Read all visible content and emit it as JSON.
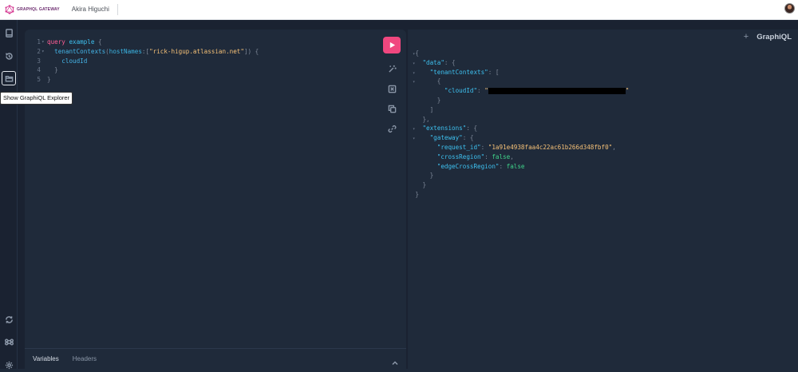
{
  "header": {
    "logo_text": "GRAPHQL GATEWAY",
    "user_name": "Akira Higuchi"
  },
  "sidebar": {
    "tooltip": "Show GraphiQL Explorer"
  },
  "editor": {
    "line_numbers": [
      "1",
      "2",
      "3",
      "4",
      "5"
    ],
    "query_keyword": "query",
    "operation_name": "example",
    "field": "tenantContexts",
    "arg_name": "hostNames",
    "arg_value": "\"rick-higup.atlassian.net\"",
    "subfield": "cloudId",
    "tabs": {
      "variables": "Variables",
      "headers": "Headers"
    }
  },
  "result_header": {
    "plus": "+",
    "brand": "GraphiQL"
  },
  "result": {
    "k_data": "\"data\"",
    "k_tenant": "\"tenantContexts\"",
    "k_cloud": "\"cloudId\"",
    "k_ext": "\"extensions\"",
    "k_gateway": "\"gateway\"",
    "k_req": "\"request_id\"",
    "v_req": "\"1a91e4938faa4c22ac61b266d348fbf0\"",
    "k_cross": "\"crossRegion\"",
    "v_cross": "false",
    "k_edge": "\"edgeCrossRegion\"",
    "v_edge": "false"
  },
  "colors": {
    "run_button": "#f0477f",
    "keyword": "#ff5c94",
    "field": "#3ec1f0",
    "string": "#f6c177",
    "boolean": "#3fd38a"
  }
}
